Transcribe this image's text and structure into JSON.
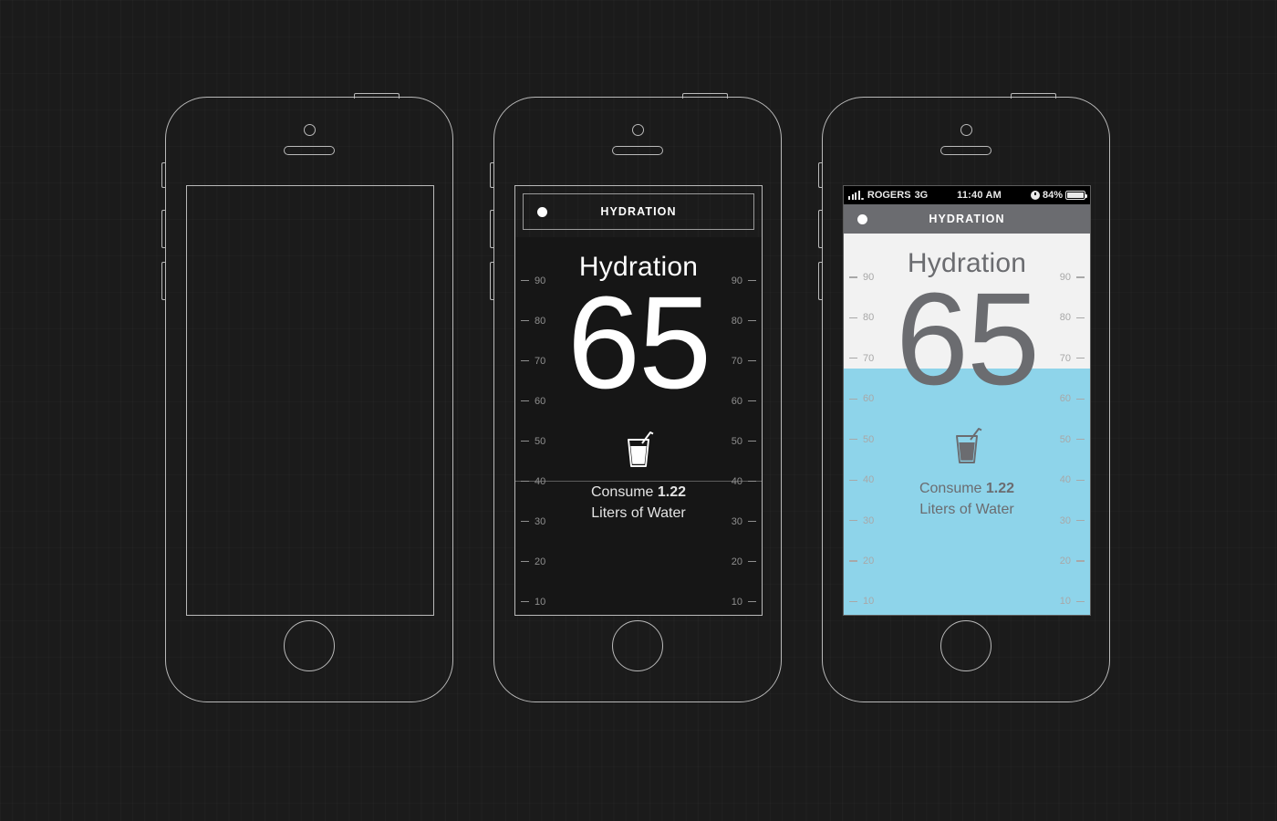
{
  "app": {
    "nav_title": "HYDRATION",
    "screen_title": "Hydration"
  },
  "status_bar": {
    "carrier": "ROGERS",
    "network": "3G",
    "time": "11:40 AM",
    "battery_percent": "84%",
    "signal_icon": "signal-bars-icon",
    "alarm_icon": "alarm-clock-icon",
    "battery_icon": "battery-icon"
  },
  "gauge": {
    "value": "65",
    "ticks": [
      "90",
      "80",
      "70",
      "60",
      "50",
      "40",
      "30",
      "20",
      "10"
    ],
    "water_level_label": "65"
  },
  "consume": {
    "prefix": "Consume ",
    "amount": "1.22",
    "suffix": "Liters of Water",
    "icon": "water-glass-icon"
  },
  "colors": {
    "water": "#8ed4ea",
    "panel_light": "#f2f2f2",
    "navbar_gray": "#6b6c70",
    "panel_dark": "#161616",
    "wire_stroke": "#b9b9b9"
  },
  "chart_data": {
    "type": "bar",
    "title": "Hydration",
    "categories": [
      "Hydration"
    ],
    "values": [
      65
    ],
    "ylabel": "",
    "xlabel": "",
    "ylim": [
      0,
      100
    ],
    "tick_values": [
      90,
      80,
      70,
      60,
      50,
      40,
      30,
      20,
      10
    ],
    "annotation": "Consume 1.22 Liters of Water",
    "grid": false,
    "legend": "none"
  },
  "phones": [
    {
      "name": "wireframe-blank",
      "has_screen_content": false
    },
    {
      "name": "wireframe-dark",
      "has_screen_content": true
    },
    {
      "name": "design-final",
      "has_screen_content": true
    }
  ]
}
